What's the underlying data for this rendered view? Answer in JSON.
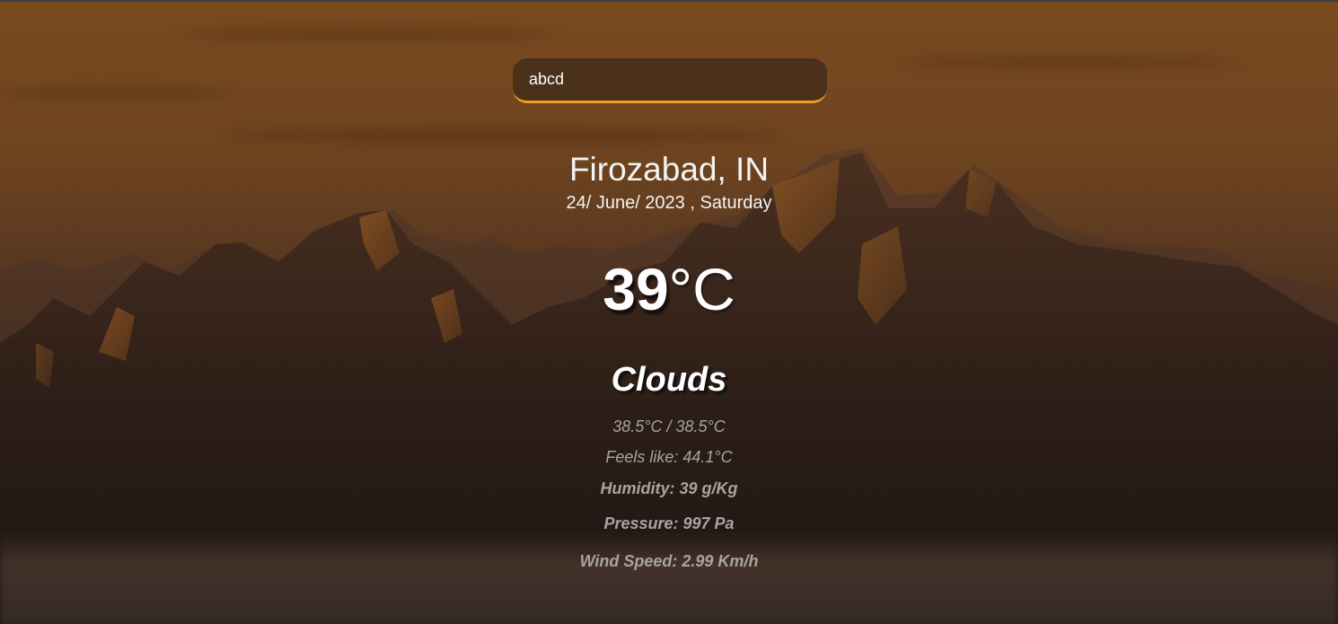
{
  "search": {
    "value": "abcd"
  },
  "location": {
    "city": "Firozabad, IN",
    "date": "24/ June/ 2023 , Saturday"
  },
  "weather": {
    "temp_value": "39",
    "temp_unit": "°C",
    "condition": "Clouds",
    "min_max": "38.5°C / 38.5°C",
    "feels_like": "Feels like: 44.1°C",
    "humidity": "Humidity: 39 g/Kg",
    "pressure": "Pressure: 997 Pa",
    "wind_speed": "Wind Speed: 2.99 Km/h"
  },
  "colors": {
    "search_accent": "#f0a020",
    "text_primary": "#ffffff",
    "text_secondary": "#a8a4a0"
  }
}
